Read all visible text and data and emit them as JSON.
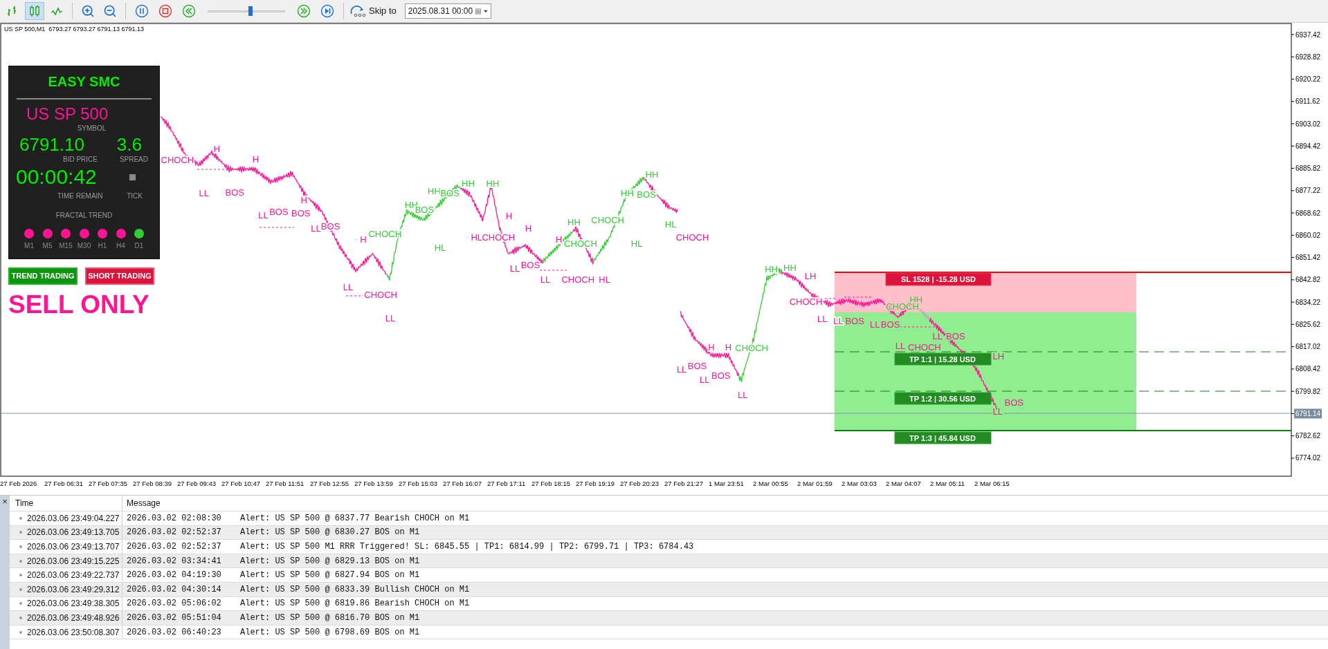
{
  "toolbar": {
    "chart_types": [
      {
        "kind": "bars",
        "selected": false
      },
      {
        "kind": "candles",
        "selected": true
      },
      {
        "kind": "line",
        "selected": false
      }
    ],
    "zoom": [
      {
        "kind": "zoom_in"
      },
      {
        "kind": "zoom_out"
      }
    ],
    "playback": [
      {
        "kind": "pause"
      },
      {
        "kind": "stop"
      },
      {
        "kind": "rewind"
      }
    ],
    "speed": {
      "level": 0.55
    },
    "playback_after": [
      {
        "kind": "fast_forward"
      },
      {
        "kind": "step_end"
      }
    ],
    "skip_to": {
      "label": "Skip to",
      "value": "2025.08.31 00:00"
    }
  },
  "chart": {
    "header": "US SP 500,M1  6793.27 6793.27 6791.13 6791.13",
    "price_ticks": [
      {
        "label": "6937.42",
        "current": false
      },
      {
        "label": "6928.82",
        "current": false
      },
      {
        "label": "6920.22",
        "current": false
      },
      {
        "label": "6911.62",
        "current": false
      },
      {
        "label": "6903.02",
        "current": false
      },
      {
        "label": "6894.42",
        "current": false
      },
      {
        "label": "6885.82",
        "current": false
      },
      {
        "label": "6877.22",
        "current": false
      },
      {
        "label": "6868.62",
        "current": false
      },
      {
        "label": "6860.02",
        "current": false
      },
      {
        "label": "6851.42",
        "current": false
      },
      {
        "label": "6842.82",
        "current": false
      },
      {
        "label": "6834.22",
        "current": false
      },
      {
        "label": "6825.62",
        "current": false
      },
      {
        "label": "6817.02",
        "current": false
      },
      {
        "label": "6808.42",
        "current": false
      },
      {
        "label": "6799.82",
        "current": false
      },
      {
        "label": "6791.14",
        "current": true
      },
      {
        "label": "6782.62",
        "current": false
      },
      {
        "label": "6774.02",
        "current": false
      }
    ],
    "time_labels": [
      "27 Feb 2026",
      "27 Feb 06:31",
      "27 Feb 07:35",
      "27 Feb 08:39",
      "27 Feb 09:43",
      "27 Feb 10:47",
      "27 Feb 11:51",
      "27 Feb 12:55",
      "27 Feb 13:59",
      "27 Feb 15:03",
      "27 Feb 16:07",
      "27 Feb 17:11",
      "27 Feb 18:15",
      "27 Feb 19:19",
      "27 Feb 20:23",
      "27 Feb 21:27",
      "1 Mar 23:51",
      "2 Mar 00:55",
      "2 Mar 01:59",
      "2 Mar 03:03",
      "2 Mar 04:07",
      "2 Mar 05:11",
      "2 Mar 06:15"
    ],
    "trade": {
      "sl": "SL 1528 | -15.28 USD",
      "tps": [
        "TP 1:1 | 15.28 USD",
        "TP 1:2 | 30.56 USD",
        "TP 1:3 | 45.84 USD"
      ]
    },
    "structure_labels": [
      {
        "text": "CHOCH",
        "kind": "bearish"
      },
      {
        "text": "H",
        "kind": "bearish"
      },
      {
        "text": "LL",
        "kind": "bearish"
      },
      {
        "text": "BOS",
        "kind": "bearish"
      },
      {
        "text": "H",
        "kind": "bearish"
      },
      {
        "text": "LL",
        "kind": "bearish"
      },
      {
        "text": "BOS",
        "kind": "bearish"
      },
      {
        "text": "BOS",
        "kind": "bearish"
      },
      {
        "text": "H",
        "kind": "bearish"
      },
      {
        "text": "LL",
        "kind": "bearish"
      },
      {
        "text": "BOS",
        "kind": "bearish"
      },
      {
        "text": "LL",
        "kind": "bearish"
      },
      {
        "text": "H",
        "kind": "bearish"
      },
      {
        "text": "CHOCH",
        "kind": "bullish"
      },
      {
        "text": "CHOCH",
        "kind": "bearish"
      },
      {
        "text": "LL",
        "kind": "bearish"
      },
      {
        "text": "HH",
        "kind": "bullish"
      },
      {
        "text": "BOS",
        "kind": "bullish"
      },
      {
        "text": "HH",
        "kind": "bullish"
      },
      {
        "text": "BOS",
        "kind": "bullish"
      },
      {
        "text": "HL",
        "kind": "bullish"
      },
      {
        "text": "HH",
        "kind": "bullish"
      },
      {
        "text": "HH",
        "kind": "bullish"
      },
      {
        "text": "H",
        "kind": "bearish"
      },
      {
        "text": "HL",
        "kind": "bearish"
      },
      {
        "text": "CHOCH",
        "kind": "bearish"
      },
      {
        "text": "H",
        "kind": "bearish"
      },
      {
        "text": "LL",
        "kind": "bearish"
      },
      {
        "text": "BOS",
        "kind": "bearish"
      },
      {
        "text": "LL",
        "kind": "bearish"
      },
      {
        "text": "HH",
        "kind": "bullish"
      },
      {
        "text": "CHOCH",
        "kind": "bullish"
      },
      {
        "text": "H",
        "kind": "bearish"
      },
      {
        "text": "CHOCH",
        "kind": "bullish"
      },
      {
        "text": "CHOCH",
        "kind": "bearish"
      },
      {
        "text": "HL",
        "kind": "bearish"
      },
      {
        "text": "HH",
        "kind": "bullish"
      },
      {
        "text": "BOS",
        "kind": "bullish"
      },
      {
        "text": "HH",
        "kind": "bullish"
      },
      {
        "text": "HL",
        "kind": "bullish"
      },
      {
        "text": "HL",
        "kind": "bullish"
      },
      {
        "text": "CHOCH",
        "kind": "bearish"
      },
      {
        "text": "H",
        "kind": "bearish"
      },
      {
        "text": "LL",
        "kind": "bearish"
      },
      {
        "text": "BOS",
        "kind": "bearish"
      },
      {
        "text": "LL",
        "kind": "bearish"
      },
      {
        "text": "H",
        "kind": "bearish"
      },
      {
        "text": "BOS",
        "kind": "bearish"
      },
      {
        "text": "CHOCH",
        "kind": "bullish"
      },
      {
        "text": "LL",
        "kind": "bearish"
      },
      {
        "text": "HH",
        "kind": "bullish"
      },
      {
        "text": "HH",
        "kind": "bullish"
      },
      {
        "text": "LH",
        "kind": "bearish"
      },
      {
        "text": "CHOCH",
        "kind": "bearish"
      },
      {
        "text": "LL",
        "kind": "bearish"
      },
      {
        "text": "LL",
        "kind": "bearish"
      },
      {
        "text": "BOS",
        "kind": "bearish"
      },
      {
        "text": "LL",
        "kind": "bearish"
      },
      {
        "text": "BOS",
        "kind": "bearish"
      },
      {
        "text": "HH",
        "kind": "bullish"
      },
      {
        "text": "CHOCH",
        "kind": "bullish"
      },
      {
        "text": "LL",
        "kind": "bearish"
      },
      {
        "text": "LL",
        "kind": "bearish"
      },
      {
        "text": "BOS",
        "kind": "bearish"
      },
      {
        "text": "CHOCH",
        "kind": "bearish"
      },
      {
        "text": "LH",
        "kind": "bearish"
      },
      {
        "text": "LL",
        "kind": "bearish"
      },
      {
        "text": "BOS",
        "kind": "bearish"
      }
    ]
  },
  "panel": {
    "title": "EASY SMC",
    "symbol": "US SP 500",
    "symbol_caption": "SYMBOL",
    "bid": "6791.10",
    "bid_caption": "BID PRICE",
    "spread": "3.6",
    "spread_caption": "SPREAD",
    "time_remain": "00:00:42",
    "time_caption": "TIME REMAIN",
    "tick_caption": "TICK",
    "trend_caption": "FRACTAL TREND",
    "fractal_trend": [
      {
        "label": "M1",
        "color": "#ff1493"
      },
      {
        "label": "M5",
        "color": "#ff1493"
      },
      {
        "label": "M15",
        "color": "#ff1493"
      },
      {
        "label": "M30",
        "color": "#ff1493"
      },
      {
        "label": "H1",
        "color": "#ff1493"
      },
      {
        "label": "H4",
        "color": "#ff1493"
      },
      {
        "label": "D1",
        "color": "#32cd32"
      }
    ]
  },
  "buttons": [
    {
      "label": "TREND TRADING",
      "kind": "trend"
    },
    {
      "label": "SHORT TRADING",
      "kind": "short"
    }
  ],
  "signal": "SELL ONLY",
  "journal": {
    "close": "×",
    "columns": [
      "Time",
      "Message"
    ],
    "rows": [
      {
        "time": "2026.03.06 23:49:04.227",
        "date": "2026.03.02 02:08:30",
        "message": "Alert: US SP 500 @ 6837.77 Bearish CHOCH on M1"
      },
      {
        "time": "2026.03.06 23:49:13.705",
        "date": "2026.03.02 02:52:37",
        "message": "Alert: US SP 500 @ 6830.27 BOS on M1"
      },
      {
        "time": "2026.03.06 23:49:13.707",
        "date": "2026.03.02 02:52:37",
        "message": "Alert: US SP 500 M1 RRR Triggered! SL: 6845.55 | TP1: 6814.99 | TP2: 6799.71 | TP3: 6784.43"
      },
      {
        "time": "2026.03.06 23:49:15.225",
        "date": "2026.03.02 03:34:41",
        "message": "Alert: US SP 500 @ 6829.13 BOS on M1"
      },
      {
        "time": "2026.03.06 23:49:22.737",
        "date": "2026.03.02 04:19:30",
        "message": "Alert: US SP 500 @ 6827.94 BOS on M1"
      },
      {
        "time": "2026.03.06 23:49:29.312",
        "date": "2026.03.02 04:30:14",
        "message": "Alert: US SP 500 @ 6833.39 Bullish CHOCH on M1"
      },
      {
        "time": "2026.03.06 23:49:38.305",
        "date": "2026.03.02 05:06:02",
        "message": "Alert: US SP 500 @ 6819.86 Bearish CHOCH on M1"
      },
      {
        "time": "2026.03.06 23:49:48.926",
        "date": "2026.03.02 05:51:04",
        "message": "Alert: US SP 500 @ 6816.70 BOS on M1"
      },
      {
        "time": "2026.03.06 23:50:08.307",
        "date": "2026.03.02 06:40:23",
        "message": "Alert: US SP 500 @ 6798.69 BOS on M1"
      }
    ]
  }
}
